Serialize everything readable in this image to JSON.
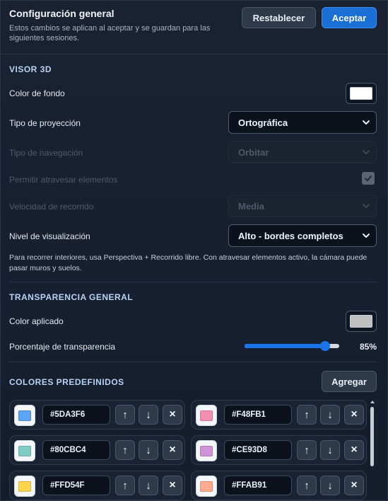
{
  "header": {
    "title": "Configuración general",
    "subtitle": "Estos cambios se aplican al aceptar y se guardan para las siguientes sesiones.",
    "reset_label": "Restablecer",
    "accept_label": "Aceptar"
  },
  "viewer": {
    "section_title": "VISOR 3D",
    "bg_color_label": "Color de fondo",
    "bg_color": "#FFFFFF",
    "projection_label": "Tipo de proyección",
    "projection_value": "Ortográfica",
    "navigation_label": "Tipo de navegación",
    "navigation_value": "Orbitar",
    "pass_through_label": "Permitir atravesar elementos",
    "pass_through_checked": true,
    "speed_label": "Velocidad de recorrido",
    "speed_value": "Media",
    "level_label": "Nivel de visualización",
    "level_value": "Alto - bordes completos",
    "help_text": "Para recorrer interiores, usa Perspectiva + Recorrido libre. Con atravesar elementos activo, la cámara puede pasar muros y suelos."
  },
  "transparency": {
    "section_title": "TRANSPARENCIA GENERAL",
    "color_label": "Color aplicado",
    "color": "#C0C0C0",
    "percent_label": "Porcentaje de transparencia",
    "percent_value": 85,
    "percent_text": "85%"
  },
  "presets": {
    "section_title": "COLORES PREDEFINIDOS",
    "add_label": "Agregar",
    "up_glyph": "↑",
    "down_glyph": "↓",
    "delete_glyph": "×",
    "items": [
      {
        "hex": "#5DA3F6"
      },
      {
        "hex": "#F48FB1"
      },
      {
        "hex": "#80CBC4"
      },
      {
        "hex": "#CE93D8"
      },
      {
        "hex": "#FFD54F"
      },
      {
        "hex": "#FFAB91"
      }
    ]
  },
  "colors": {
    "accent": "#1A73E8",
    "background": "#161E2C"
  }
}
